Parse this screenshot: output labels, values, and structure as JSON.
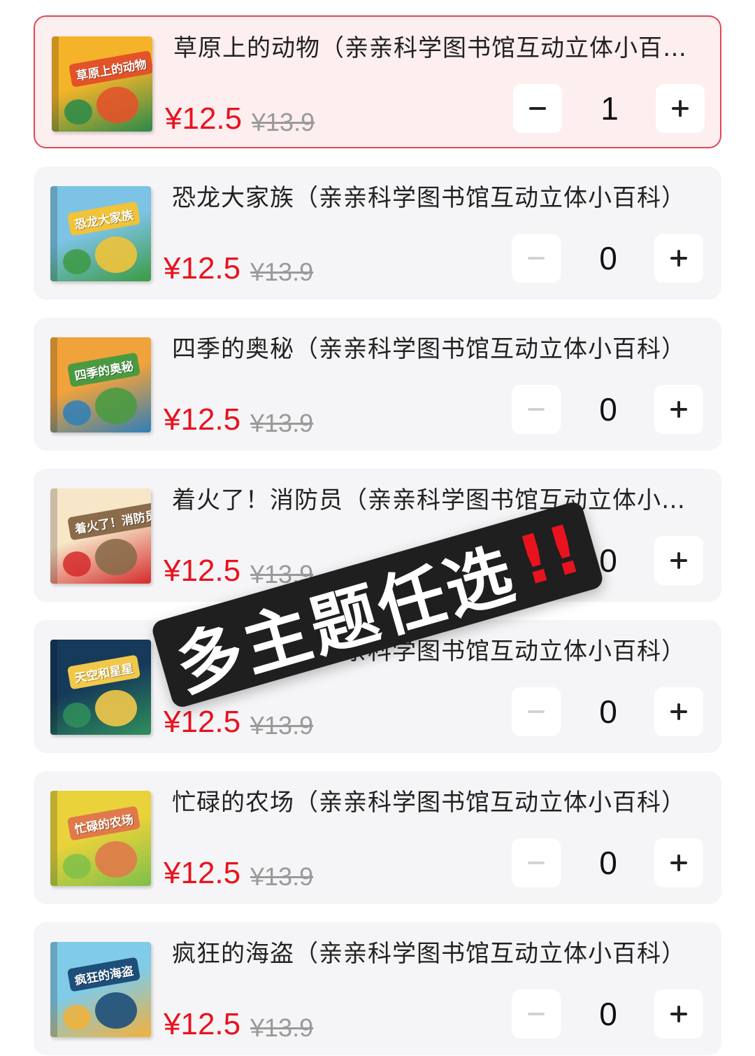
{
  "products": [
    {
      "title": "草原上的动物（亲亲科学图书馆互动立体小百科）",
      "cover_label": "草原上的动物",
      "price": "¥12.5",
      "original_price": "¥13.9",
      "quantity": "1",
      "selected": true,
      "cover_colors": [
        "#f4b329",
        "#2a8a4a",
        "#e2532a"
      ]
    },
    {
      "title": "恐龙大家族（亲亲科学图书馆互动立体小百科）",
      "cover_label": "恐龙大家族",
      "price": "¥12.5",
      "original_price": "¥13.9",
      "quantity": "0",
      "selected": false,
      "cover_colors": [
        "#7cc3e6",
        "#3c9a43",
        "#f0c33a"
      ]
    },
    {
      "title": "四季的奥秘（亲亲科学图书馆互动立体小百科）",
      "cover_label": "四季的奥秘",
      "price": "¥12.5",
      "original_price": "¥13.9",
      "quantity": "0",
      "selected": false,
      "cover_colors": [
        "#f2a23a",
        "#2e7fb8",
        "#4b9a41"
      ]
    },
    {
      "title": "着火了！消防员（亲亲科学图书馆互动立体小百科）",
      "cover_label": "着火了！消防员",
      "price": "¥12.5",
      "original_price": "¥13.9",
      "quantity": "0",
      "selected": false,
      "cover_colors": [
        "#f7e6c8",
        "#d42b2b",
        "#8a6b4a"
      ]
    },
    {
      "title": "天空和星星（亲亲科学图书馆互动立体小百科）",
      "cover_label": "天空和星星",
      "price": "¥12.5",
      "original_price": "¥13.9",
      "quantity": "0",
      "selected": false,
      "cover_colors": [
        "#163a5a",
        "#2f8f5b",
        "#f2c84a"
      ]
    },
    {
      "title": "忙碌的农场（亲亲科学图书馆互动立体小百科）",
      "cover_label": "忙碌的农场",
      "price": "¥12.5",
      "original_price": "¥13.9",
      "quantity": "0",
      "selected": false,
      "cover_colors": [
        "#e9d23a",
        "#7fbf4a",
        "#e07a4a"
      ]
    },
    {
      "title": "疯狂的海盗（亲亲科学图书馆互动立体小百科）",
      "cover_label": "疯狂的海盗",
      "price": "¥12.5",
      "original_price": "¥13.9",
      "quantity": "0",
      "selected": false,
      "cover_colors": [
        "#7fcbe8",
        "#f2b13a",
        "#1d4f7a"
      ]
    }
  ],
  "overlay": {
    "text": "多主题任选",
    "mark": "!!"
  },
  "colors": {
    "price_red": "#e8131f",
    "selected_border": "#e04856",
    "selected_bg": "#fdeeef",
    "card_bg": "#f5f5f7"
  },
  "icons": {
    "minus": "minus-icon",
    "plus": "plus-icon"
  }
}
